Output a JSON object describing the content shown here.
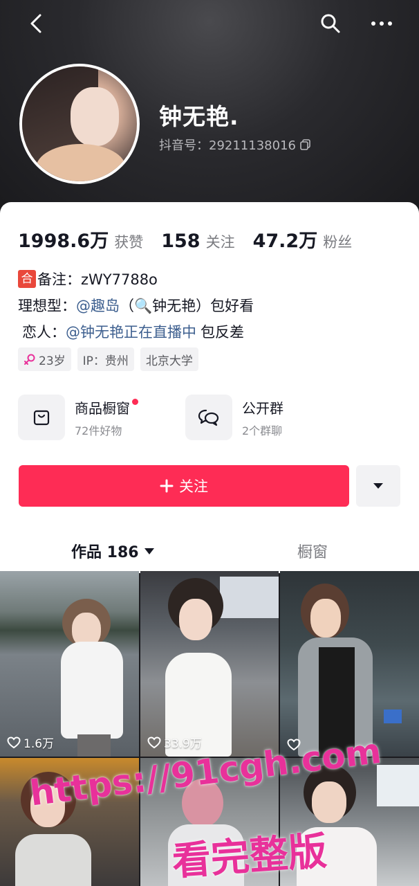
{
  "profile": {
    "username": "钟无艳.",
    "douyin_id_label": "抖音号：29211138016"
  },
  "stats": [
    {
      "value": "1998.6万",
      "label": "获赞"
    },
    {
      "value": "158",
      "label": "关注"
    },
    {
      "value": "47.2万",
      "label": "粉丝"
    }
  ],
  "bio": {
    "badge": "合",
    "line1": "备注：zWY7788o",
    "line2_prefix": "理想型：",
    "line2_mention": "@趣岛",
    "line2_suffix": "（🔍钟无艳）包好看",
    "line3_prefix": "恋人：",
    "line3_mention": "@钟无艳正在直播中",
    "line3_suffix": "包反差"
  },
  "tags": {
    "age": "23岁",
    "ip": "IP：贵州",
    "school": "北京大学"
  },
  "entries": {
    "shop_title": "商品橱窗",
    "shop_sub": "72件好物",
    "group_title": "公开群",
    "group_sub": "2个群聊"
  },
  "actions": {
    "follow_label": "关注"
  },
  "tabs": {
    "works": "作品 186",
    "shop": "橱窗"
  },
  "videos": [
    {
      "likes": "1.6万"
    },
    {
      "likes": "33.9万"
    },
    {
      "likes": ""
    }
  ],
  "watermark": {
    "url": "https://91cgh.com",
    "text": "看完整版"
  },
  "colors": {
    "accent": "#fe2c55",
    "mention": "#3d5f8f",
    "watermark": "#e8319a"
  }
}
